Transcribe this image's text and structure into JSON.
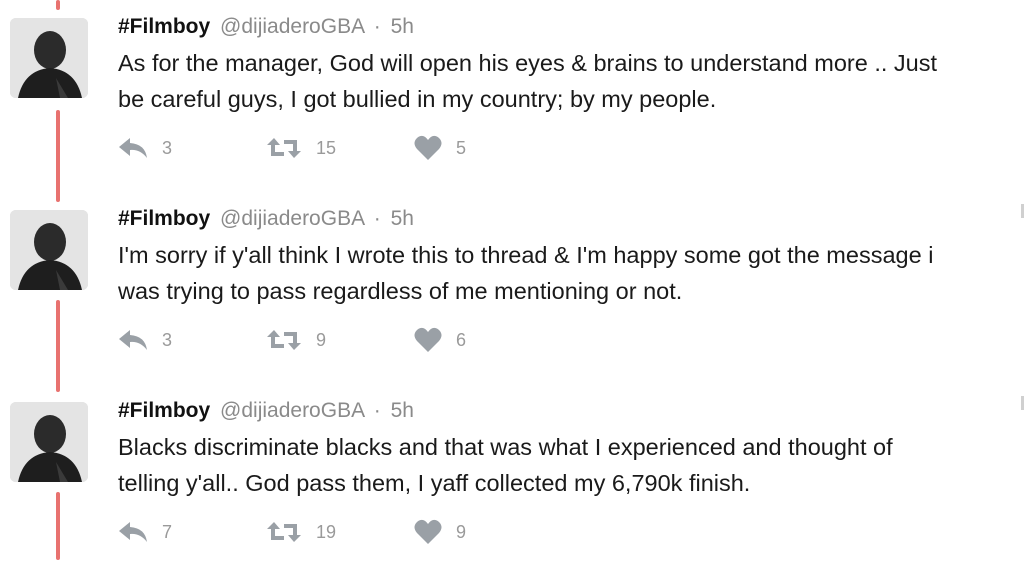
{
  "colors": {
    "thread_line": "#e8726f",
    "action_icon": "#9aa0a6",
    "meta_text": "#8a8a8a"
  },
  "tweets": [
    {
      "name": "#Filmboy",
      "handle": "@dijiaderoGBA",
      "separator": "·",
      "time": "5h",
      "text_lines": [
        "As for the manager, God will open his eyes & brains to understand more .. Just",
        "be careful guys, I got bullied in my country; by my people."
      ],
      "replies": "3",
      "retweets": "15",
      "likes": "5",
      "icons": {
        "reply": "reply-arrow-icon",
        "retweet": "retweet-icon",
        "like": "heart-icon"
      }
    },
    {
      "name": "#Filmboy",
      "handle": "@dijiaderoGBA",
      "separator": "·",
      "time": "5h",
      "text_lines": [
        "I'm sorry if y'all think I wrote this to thread & I'm happy some got the message i",
        "was trying to pass regardless of me mentioning or not."
      ],
      "replies": "3",
      "retweets": "9",
      "likes": "6",
      "icons": {
        "reply": "reply-arrow-icon",
        "retweet": "retweet-icon",
        "like": "heart-icon"
      }
    },
    {
      "name": "#Filmboy",
      "handle": "@dijiaderoGBA",
      "separator": "·",
      "time": "5h",
      "text_lines": [
        "Blacks discriminate blacks and that was what I experienced and thought of",
        "telling y'all.. God pass them, I yaff collected my 6,790k finish."
      ],
      "replies": "7",
      "retweets": "19",
      "likes": "9",
      "icons": {
        "reply": "reply-arrow-icon",
        "retweet": "retweet-icon",
        "like": "heart-icon"
      }
    }
  ]
}
